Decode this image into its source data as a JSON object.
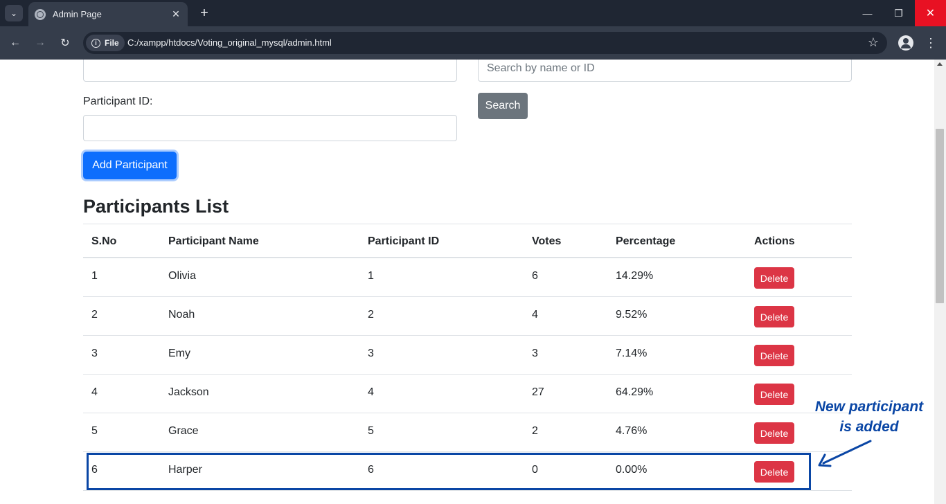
{
  "browser": {
    "tab_title": "Admin Page",
    "tab_close": "✕",
    "new_tab": "+",
    "chip_label": "File",
    "url": "C:/xampp/htdocs/Voting_original_mysql/admin.html",
    "icons": [
      "chevron-down-icon",
      "globe-icon",
      "close-icon",
      "plus-icon",
      "back-icon",
      "forward-icon",
      "reload-icon",
      "info-icon",
      "star-icon",
      "profile-icon",
      "kebab-menu-icon",
      "minimize-icon",
      "restore-icon",
      "window-close-icon"
    ]
  },
  "form": {
    "participant_id_label": "Participant ID:",
    "participant_name_value": "",
    "participant_id_value": "",
    "add_button": "Add Participant"
  },
  "search": {
    "placeholder": "Search by name or ID",
    "button": "Search"
  },
  "participants": {
    "heading": "Participants List",
    "columns": [
      "S.No",
      "Participant Name",
      "Participant ID",
      "Votes",
      "Percentage",
      "Actions"
    ],
    "rows": [
      {
        "sno": "1",
        "name": "Olivia",
        "id": "1",
        "votes": "6",
        "percentage": "14.29%",
        "action": "Delete"
      },
      {
        "sno": "2",
        "name": "Noah",
        "id": "2",
        "votes": "4",
        "percentage": "9.52%",
        "action": "Delete"
      },
      {
        "sno": "3",
        "name": "Emy",
        "id": "3",
        "votes": "3",
        "percentage": "7.14%",
        "action": "Delete"
      },
      {
        "sno": "4",
        "name": "Jackson",
        "id": "4",
        "votes": "27",
        "percentage": "64.29%",
        "action": "Delete"
      },
      {
        "sno": "5",
        "name": "Grace",
        "id": "5",
        "votes": "2",
        "percentage": "4.76%",
        "action": "Delete"
      },
      {
        "sno": "6",
        "name": "Harper",
        "id": "6",
        "votes": "0",
        "percentage": "0.00%",
        "action": "Delete"
      }
    ]
  },
  "annotation": {
    "line1": "New participant",
    "line2": "is added",
    "color": "#0a46a5"
  },
  "colors": {
    "primary": "#0d6efd",
    "secondary": "#6c757d",
    "danger": "#dc3545"
  }
}
